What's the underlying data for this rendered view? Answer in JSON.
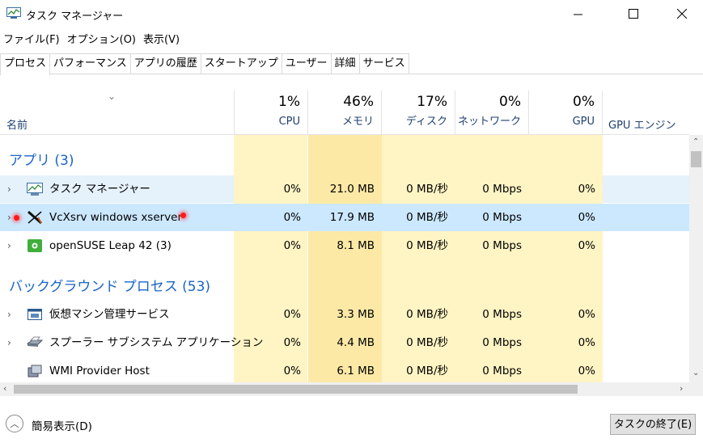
{
  "window": {
    "title": "タスク マネージャー"
  },
  "menu": [
    "ファイル(F)",
    "オプション(O)",
    "表示(V)"
  ],
  "tabs": [
    "プロセス",
    "パフォーマンス",
    "アプリの履歴",
    "スタートアップ",
    "ユーザー",
    "詳細",
    "サービス"
  ],
  "header": {
    "name_label": "名前",
    "columns": [
      {
        "pct": "1%",
        "label": "CPU"
      },
      {
        "pct": "46%",
        "label": "メモリ"
      },
      {
        "pct": "17%",
        "label": "ディスク"
      },
      {
        "pct": "0%",
        "label": "ネットワーク"
      },
      {
        "pct": "0%",
        "label": "GPU"
      },
      {
        "pct": "",
        "label": "GPU エンジン"
      }
    ]
  },
  "groups": {
    "apps": "アプリ (3)",
    "background": "バックグラウンド プロセス (53)"
  },
  "rows": [
    {
      "name": "タスク マネージャー",
      "cpu": "0%",
      "mem": "21.0 MB",
      "disk": "0 MB/秒",
      "net": "0 Mbps",
      "gpu": "0%"
    },
    {
      "name": "VcXsrv windows xserver",
      "cpu": "0%",
      "mem": "17.9 MB",
      "disk": "0 MB/秒",
      "net": "0 Mbps",
      "gpu": "0%"
    },
    {
      "name": "openSUSE Leap 42 (3)",
      "cpu": "0%",
      "mem": "8.1 MB",
      "disk": "0 MB/秒",
      "net": "0 Mbps",
      "gpu": "0%"
    },
    {
      "name": "仮想マシン管理サービス",
      "cpu": "0%",
      "mem": "3.3 MB",
      "disk": "0 MB/秒",
      "net": "0 Mbps",
      "gpu": "0%"
    },
    {
      "name": "スプーラー サブシステム アプリケーション",
      "cpu": "0%",
      "mem": "4.4 MB",
      "disk": "0 MB/秒",
      "net": "0 Mbps",
      "gpu": "0%"
    },
    {
      "name": "WMI Provider Host",
      "cpu": "0%",
      "mem": "6.1 MB",
      "disk": "0 MB/秒",
      "net": "0 Mbps",
      "gpu": "0%"
    }
  ],
  "footer": {
    "fewer_details": "簡易表示(D)",
    "end_task": "タスクの終了(E)"
  }
}
